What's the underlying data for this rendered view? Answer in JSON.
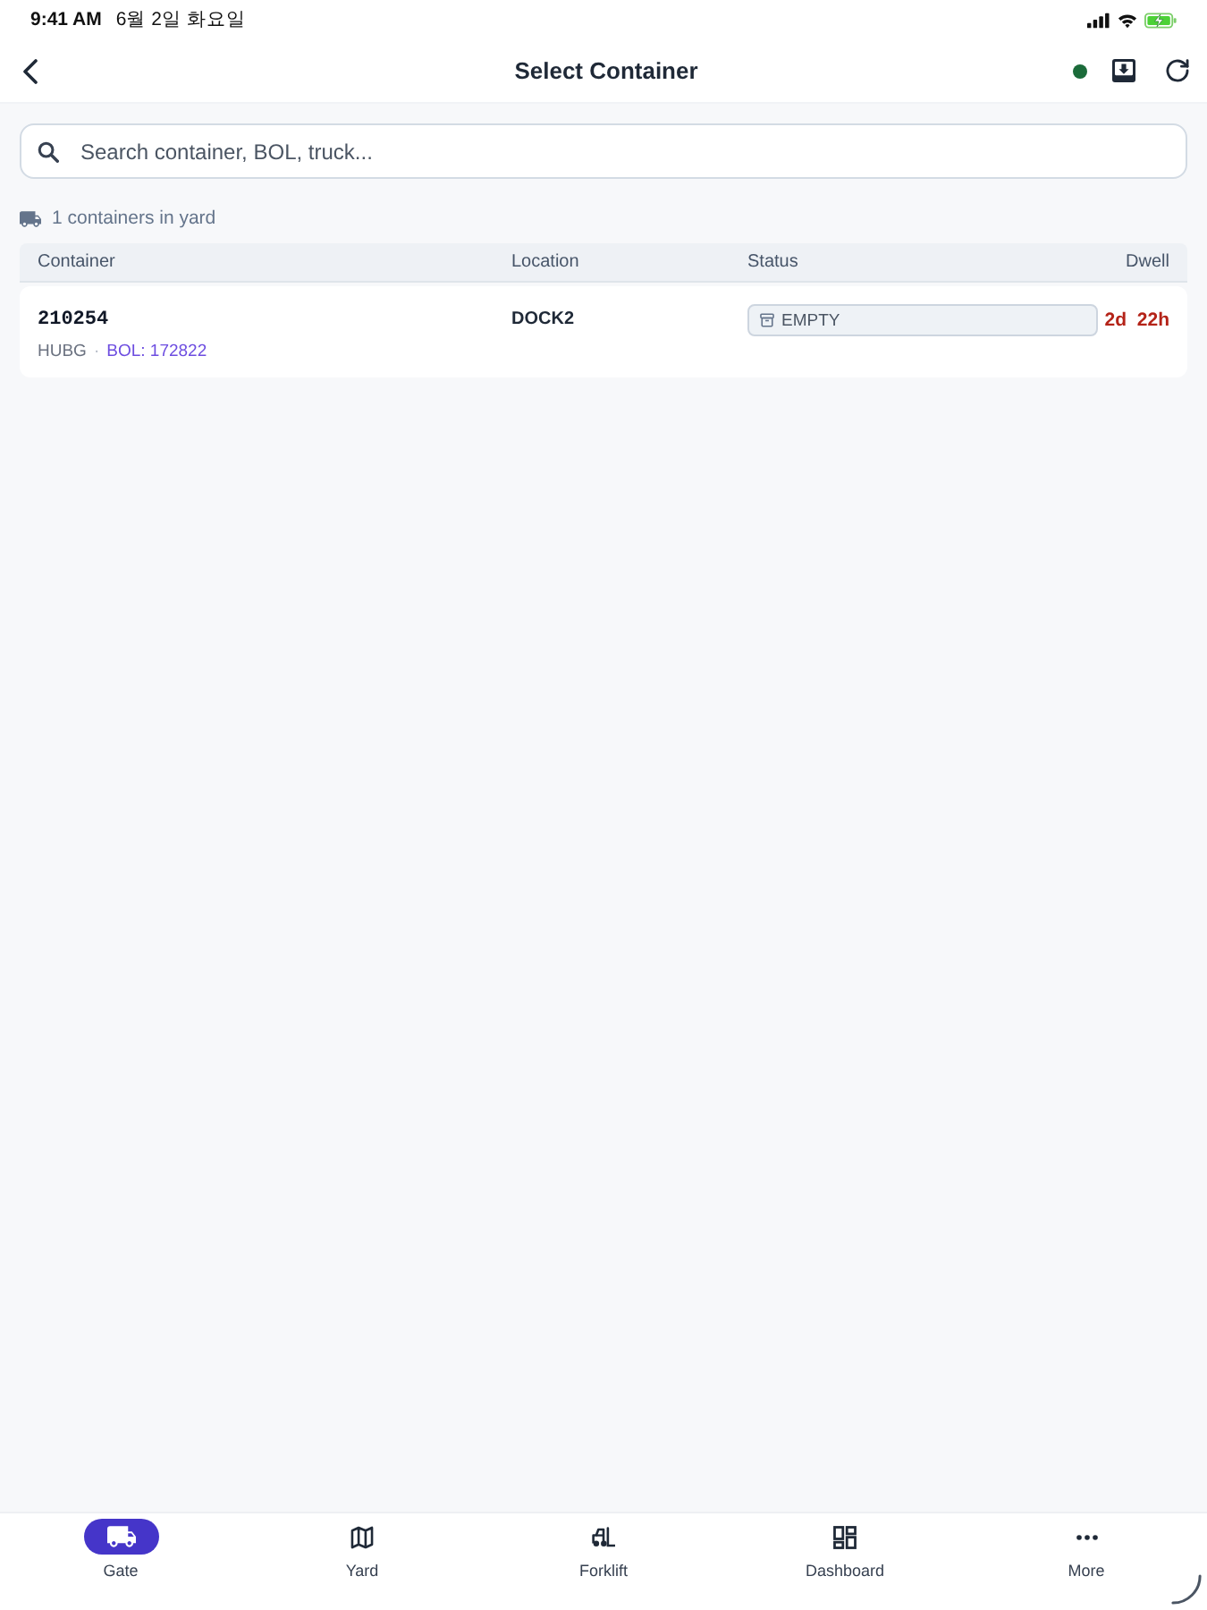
{
  "status_bar": {
    "time": "9:41 AM",
    "date": "6월 2일 화요일"
  },
  "header": {
    "title": "Select Container",
    "connected": true
  },
  "search": {
    "placeholder": "Search container, BOL, truck..."
  },
  "summary": "1 containers in yard",
  "table": {
    "columns": [
      "Container",
      "Location",
      "Status",
      "Dwell"
    ],
    "rows": [
      {
        "container": "210254",
        "carrier": "HUBG",
        "separator": "·",
        "bol": "BOL: 172822",
        "location": "DOCK2",
        "status": {
          "label": "EMPTY",
          "kind": "empty"
        },
        "dwell": "2d 22h"
      }
    ]
  },
  "nav": [
    {
      "label": "Gate",
      "kind": "gate",
      "selected": true
    },
    {
      "label": "Yard",
      "kind": "yard",
      "selected": false
    },
    {
      "label": "Forklift",
      "kind": "forklift",
      "selected": false
    },
    {
      "label": "Dashboard",
      "kind": "dashboard",
      "selected": false
    },
    {
      "label": "More",
      "kind": "more",
      "selected": false
    }
  ]
}
